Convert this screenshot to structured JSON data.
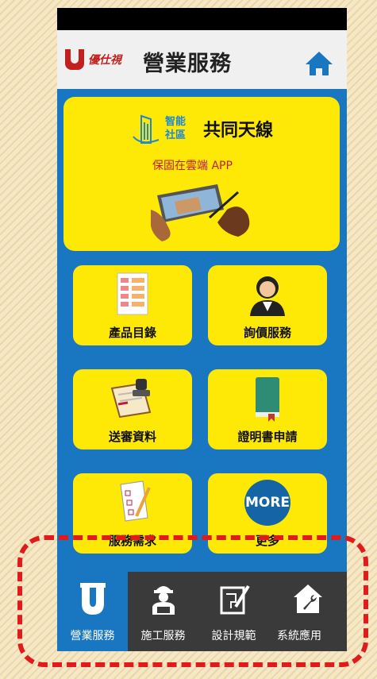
{
  "header": {
    "logo_text": "優仕視",
    "title": "營業服務"
  },
  "banner": {
    "tag_line1": "智能",
    "tag_line2": "社區",
    "title": "共同天線",
    "subtitle": "保固在雲端 APP"
  },
  "tiles": [
    {
      "label": "產品目錄",
      "icon": "catalog-icon"
    },
    {
      "label": "詢價服務",
      "icon": "customer-service-icon"
    },
    {
      "label": "送審資料",
      "icon": "stamp-document-icon"
    },
    {
      "label": "證明書申請",
      "icon": "certificate-book-icon"
    },
    {
      "label": "服務需求",
      "icon": "checklist-icon"
    },
    {
      "label": "更多",
      "icon": "more-icon",
      "badge": "MORE"
    }
  ],
  "tabbar": [
    {
      "label": "營業服務",
      "icon": "unys-logo-icon",
      "active": true
    },
    {
      "label": "施工服務",
      "icon": "worker-icon",
      "active": false
    },
    {
      "label": "設計規範",
      "icon": "blueprint-icon",
      "active": false
    },
    {
      "label": "系統應用",
      "icon": "house-wrench-icon",
      "active": false
    }
  ],
  "colors": {
    "primary_blue": "#1976c0",
    "tile_yellow": "#fde806",
    "tabbar_dark": "#3a3a3a",
    "highlight_red": "#e11b1b"
  }
}
